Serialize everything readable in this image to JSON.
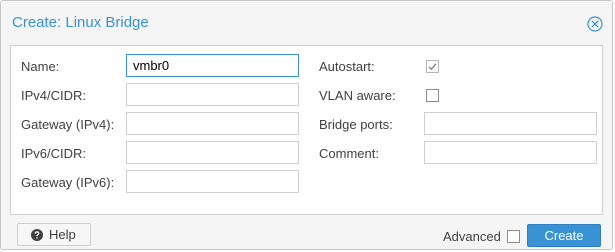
{
  "window": {
    "title": "Create: Linux Bridge"
  },
  "form": {
    "left": [
      {
        "label": "Name:",
        "value": "vmbr0"
      },
      {
        "label": "IPv4/CIDR:",
        "value": ""
      },
      {
        "label": "Gateway (IPv4):",
        "value": ""
      },
      {
        "label": "IPv6/CIDR:",
        "value": ""
      },
      {
        "label": "Gateway (IPv6):",
        "value": ""
      }
    ],
    "right": {
      "autostart": {
        "label": "Autostart:",
        "checked": true
      },
      "vlan_aware": {
        "label": "VLAN aware:",
        "checked": false
      },
      "bridge_ports": {
        "label": "Bridge ports:",
        "value": ""
      },
      "comment": {
        "label": "Comment:",
        "value": ""
      }
    }
  },
  "footer": {
    "help_label": "Help",
    "advanced_label": "Advanced",
    "advanced_checked": false,
    "create_label": "Create"
  },
  "colors": {
    "accent": "#3892d4",
    "title": "#3892d4"
  },
  "icons": {
    "close": "close-circle-icon",
    "help": "question-circle-icon",
    "check": "check-icon"
  }
}
